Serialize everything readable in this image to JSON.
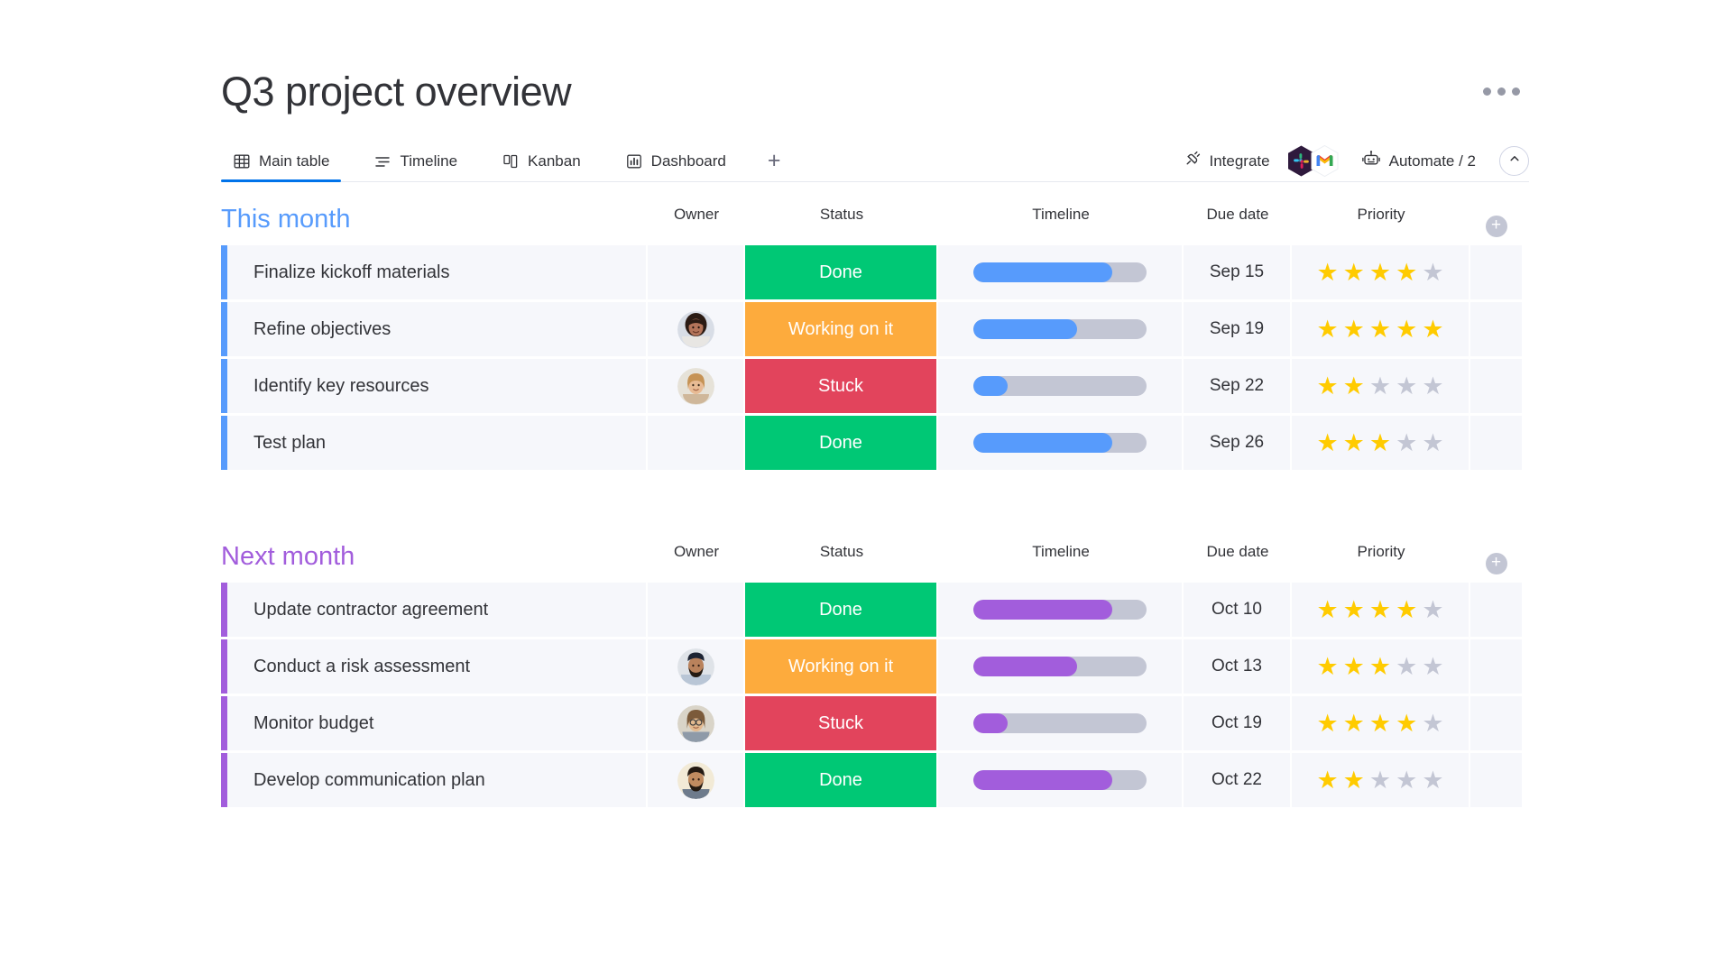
{
  "header": {
    "title": "Q3 project overview",
    "more_menu": "more-options"
  },
  "tabs": [
    {
      "label": "Main table",
      "icon": "table-icon",
      "active": true
    },
    {
      "label": "Timeline",
      "icon": "timeline-icon",
      "active": false
    },
    {
      "label": "Kanban",
      "icon": "kanban-icon",
      "active": false
    },
    {
      "label": "Dashboard",
      "icon": "dashboard-icon",
      "active": false
    }
  ],
  "tab_add_label": "+",
  "toolbar": {
    "integrate_label": "Integrate",
    "automate_label": "Automate / 2",
    "apps": [
      "slack-icon",
      "gmail-icon"
    ],
    "collapse_label": "collapse-icon"
  },
  "columns": [
    "Owner",
    "Status",
    "Timeline",
    "Due date",
    "Priority"
  ],
  "colors": {
    "accent_blue": "#0073ea",
    "group_blue": "#579bfc",
    "group_purple": "#a25ddc",
    "done_green": "#00c875",
    "working_orange": "#fdab3d",
    "stuck_red": "#e2445c",
    "star_on": "#ffcb00",
    "star_off": "#c3c6d4",
    "bar_track": "#c3c6d4",
    "row_bg": "#f6f7fb"
  },
  "groups": [
    {
      "title": "This month",
      "color": "#579bfc",
      "bar_color": "#579bfc",
      "add_column": "+",
      "rows": [
        {
          "name": "Finalize kickoff materials",
          "owner": null,
          "status": "Done",
          "status_color": "#00c875",
          "progress": 80,
          "due": "Sep 15",
          "priority": 4
        },
        {
          "name": "Refine objectives",
          "owner": "avatar-woman-1",
          "status": "Working on it",
          "status_color": "#fdab3d",
          "progress": 60,
          "due": "Sep 19",
          "priority": 5
        },
        {
          "name": "Identify key resources",
          "owner": "avatar-woman-2",
          "status": "Stuck",
          "status_color": "#e2445c",
          "progress": 20,
          "due": "Sep 22",
          "priority": 2
        },
        {
          "name": "Test plan",
          "owner": null,
          "status": "Done",
          "status_color": "#00c875",
          "progress": 80,
          "due": "Sep 26",
          "priority": 3
        }
      ]
    },
    {
      "title": "Next month",
      "color": "#a25ddc",
      "bar_color": "#a25ddc",
      "add_column": "+",
      "rows": [
        {
          "name": "Update contractor agreement",
          "owner": null,
          "status": "Done",
          "status_color": "#00c875",
          "progress": 80,
          "due": "Oct 10",
          "priority": 4
        },
        {
          "name": "Conduct a risk assessment",
          "owner": "avatar-man-1",
          "status": "Working on it",
          "status_color": "#fdab3d",
          "progress": 60,
          "due": "Oct 13",
          "priority": 3
        },
        {
          "name": "Monitor budget",
          "owner": "avatar-woman-3",
          "status": "Stuck",
          "status_color": "#e2445c",
          "progress": 20,
          "due": "Oct 19",
          "priority": 4
        },
        {
          "name": "Develop communication plan",
          "owner": "avatar-man-2",
          "status": "Done",
          "status_color": "#00c875",
          "progress": 80,
          "due": "Oct 22",
          "priority": 2
        }
      ]
    }
  ]
}
